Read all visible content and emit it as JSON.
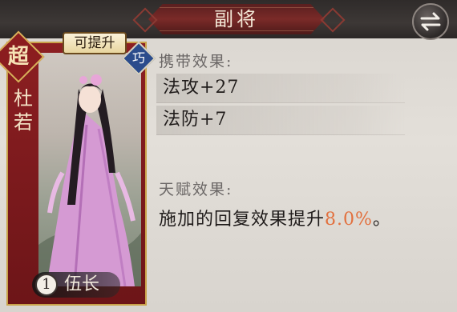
{
  "header": {
    "title": "副将"
  },
  "card": {
    "rank": "超",
    "name": "杜若",
    "upgrade_tag": "可提升",
    "skill_badge": "巧",
    "level": "1",
    "level_label": "伍长"
  },
  "carry_effects": {
    "label": "携带效果:",
    "items": [
      "法攻+27",
      "法防+7"
    ]
  },
  "talent": {
    "label": "天赋效果:",
    "text_prefix": "施加的回复效果提升",
    "value": "8.0%",
    "text_suffix": "。"
  },
  "colors": {
    "accent_value": "#e2703e",
    "card_red": "#8c1f22",
    "header_dark": "#2f2b2a"
  },
  "icons": {
    "swap": "swap-arrows-icon"
  }
}
